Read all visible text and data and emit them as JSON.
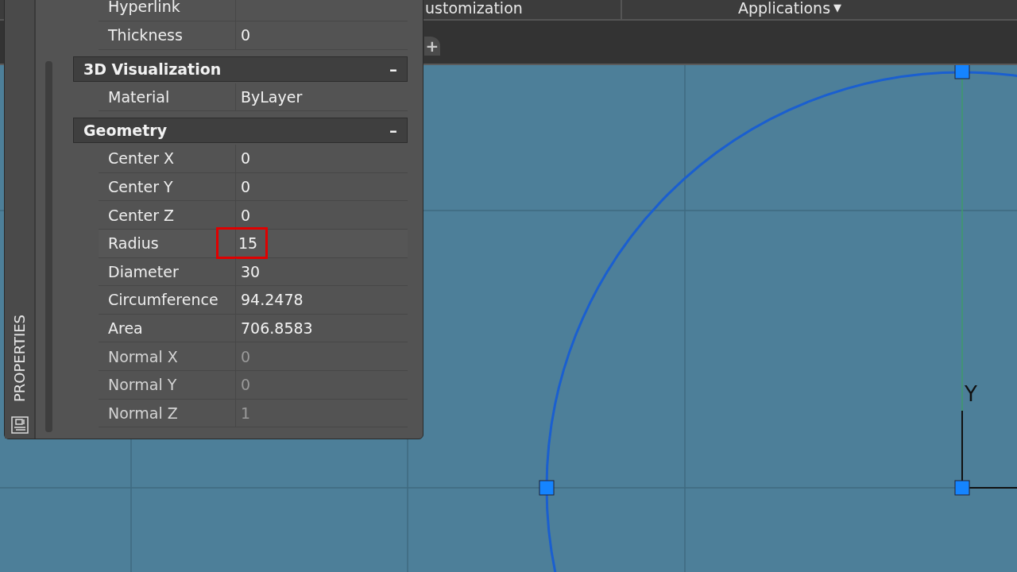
{
  "ribbon_tabs": [
    {
      "label": "ustomization"
    },
    {
      "label": "Applications",
      "caret": "▼"
    }
  ],
  "file_tabs": {
    "new_tab": "+"
  },
  "drawing": {
    "ucs_label": "Y"
  },
  "properties_palette": {
    "title": "PROPERTIES",
    "sections": [
      {
        "rows": [
          {
            "label": "Hyperlink",
            "disabled": false,
            "highlighted": false
          },
          {
            "label": "Thickness",
            "value": "0",
            "disabled": false,
            "highlighted": false
          }
        ]
      },
      {
        "title": "3D Visualization",
        "toggle": "–",
        "rows": [
          {
            "label": "Material",
            "value": "ByLayer",
            "disabled": false,
            "highlighted": false
          }
        ]
      },
      {
        "title": "Geometry",
        "toggle": "–",
        "rows": [
          {
            "label": "Center X",
            "value": "0",
            "disabled": false,
            "highlighted": false
          },
          {
            "label": "Center Y",
            "value": "0",
            "disabled": false,
            "highlighted": false
          },
          {
            "label": "Center Z",
            "value": "0",
            "disabled": false,
            "highlighted": false
          },
          {
            "label": "Radius",
            "value": "15",
            "disabled": false,
            "highlighted": true
          },
          {
            "label": "Diameter",
            "value": "30",
            "disabled": false,
            "highlighted": false
          },
          {
            "label": "Circumference",
            "value": "94.2478",
            "disabled": false,
            "highlighted": false
          },
          {
            "label": "Area",
            "value": "706.8583",
            "disabled": false,
            "highlighted": false
          },
          {
            "label": "Normal X",
            "value": "0",
            "disabled": true,
            "highlighted": false
          },
          {
            "label": "Normal Y",
            "value": "0",
            "disabled": true,
            "highlighted": false
          },
          {
            "label": "Normal Z",
            "value": "1",
            "disabled": true,
            "highlighted": false
          }
        ]
      }
    ]
  }
}
